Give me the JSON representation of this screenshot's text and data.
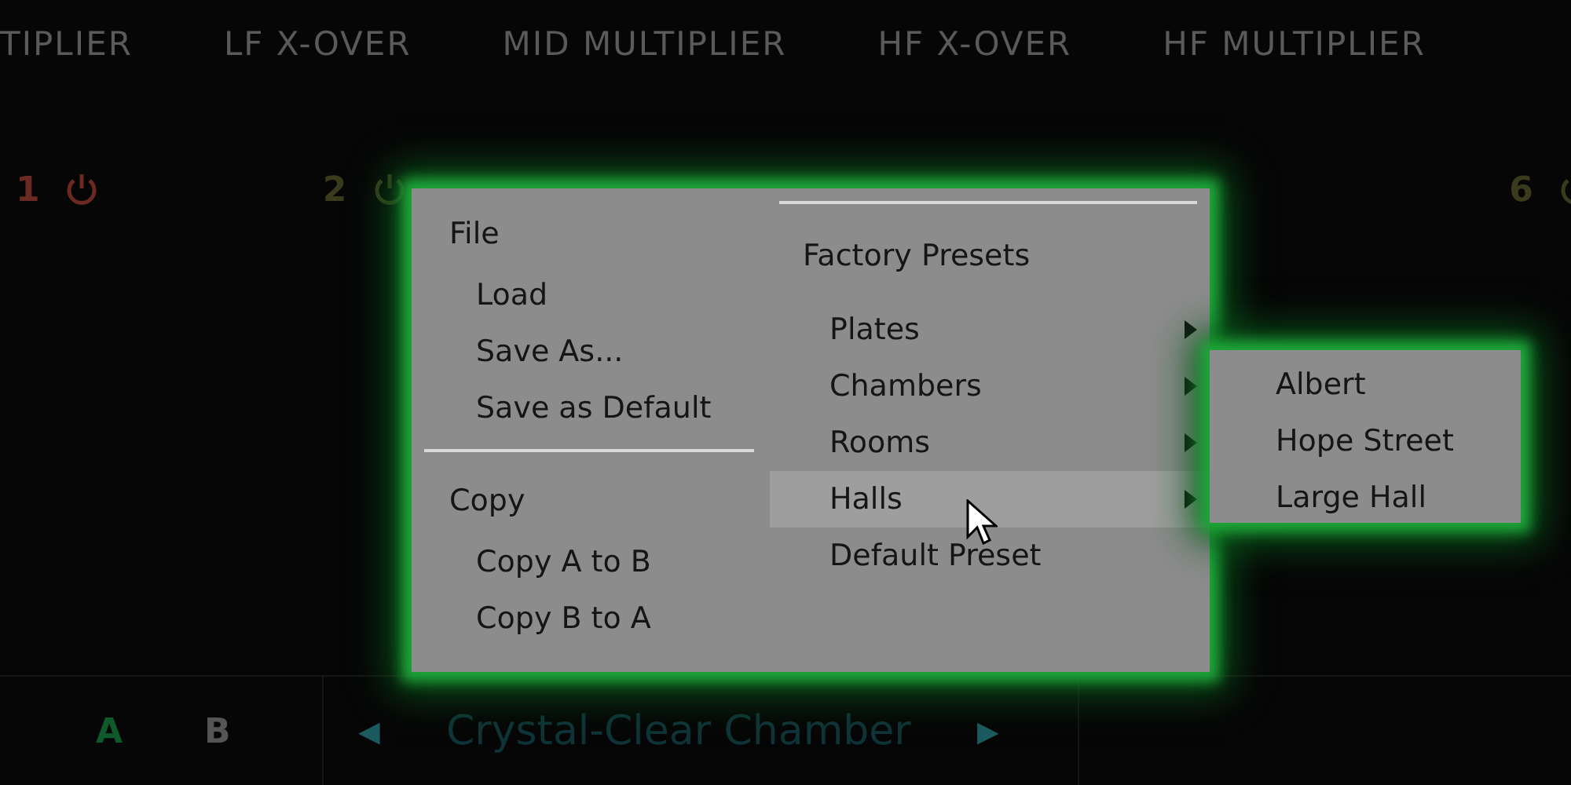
{
  "header_labels": [
    "TIPLIER",
    "LF X-OVER",
    "MID MULTIPLIER",
    "HF X-OVER",
    "HF MULTIPLIER"
  ],
  "bands": [
    {
      "number": "1",
      "color": "#6a2a22"
    },
    {
      "number": "2",
      "color": "#3a3a1c"
    },
    {
      "number": "6",
      "color": "#3a3a1c"
    }
  ],
  "ab_buttons": [
    {
      "label": "A",
      "selected": true
    },
    {
      "label": "B",
      "selected": false
    }
  ],
  "preset_bar": {
    "prev": "◀",
    "name": "Crystal-Clear Chamber",
    "next": "▶"
  },
  "menu": {
    "left": [
      {
        "kind": "header",
        "label": "File"
      },
      {
        "kind": "item",
        "label": "Load"
      },
      {
        "kind": "item",
        "label": "Save As..."
      },
      {
        "kind": "item",
        "label": "Save as Default"
      },
      {
        "kind": "separator"
      },
      {
        "kind": "header",
        "label": "Copy"
      },
      {
        "kind": "item",
        "label": "Copy A to B"
      },
      {
        "kind": "item",
        "label": "Copy B to A"
      }
    ],
    "right": [
      {
        "kind": "separator"
      },
      {
        "kind": "header",
        "label": "Factory Presets"
      },
      {
        "kind": "item",
        "label": "Plates",
        "submenu": true,
        "selected": false
      },
      {
        "kind": "item",
        "label": "Chambers",
        "submenu": true,
        "selected": false
      },
      {
        "kind": "item",
        "label": "Rooms",
        "submenu": true,
        "selected": false
      },
      {
        "kind": "item",
        "label": "Halls",
        "submenu": true,
        "selected": true
      },
      {
        "kind": "item",
        "label": "Default Preset",
        "submenu": false,
        "selected": false
      }
    ]
  },
  "submenu": [
    "Albert",
    "Hope Street",
    "Large Hall"
  ]
}
